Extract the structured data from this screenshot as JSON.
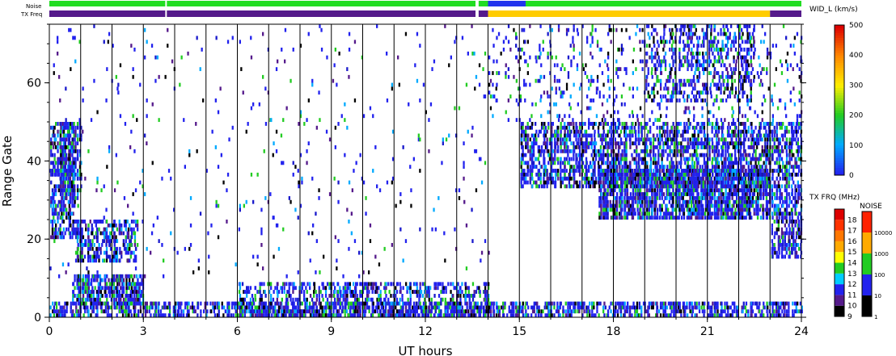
{
  "chart_data": {
    "type": "heatmap",
    "title": "",
    "xlabel": "UT hours",
    "ylabel": "Range Gate",
    "xlim": [
      0,
      24
    ],
    "ylim": [
      0,
      75
    ],
    "x_ticks": [
      "0",
      "3",
      "6",
      "9",
      "12",
      "15",
      "18",
      "21",
      "24"
    ],
    "y_ticks": [
      "0",
      "20",
      "40",
      "60"
    ],
    "hour_lines": [
      1,
      2,
      3,
      4,
      5,
      6,
      7,
      8,
      9,
      10,
      11,
      12,
      13,
      14,
      15,
      16,
      17,
      18,
      19,
      20,
      21,
      22,
      23
    ],
    "bands": {
      "noise_label": "Noise",
      "txfreq_label": "TX Freq",
      "noise_segments": [
        {
          "start": 0.0,
          "end": 3.7,
          "color": "#22dd22"
        },
        {
          "start": 3.75,
          "end": 13.6,
          "color": "#22dd22"
        },
        {
          "start": 13.7,
          "end": 14.0,
          "color": "#22dd22"
        },
        {
          "start": 14.0,
          "end": 15.2,
          "color": "#2233ee"
        },
        {
          "start": 15.2,
          "end": 24.0,
          "color": "#22dd22"
        }
      ],
      "txfreq_segments": [
        {
          "start": 0.0,
          "end": 3.7,
          "color": "#551a8b"
        },
        {
          "start": 3.75,
          "end": 13.6,
          "color": "#551a8b"
        },
        {
          "start": 13.7,
          "end": 14.0,
          "color": "#551a8b"
        },
        {
          "start": 14.0,
          "end": 23.0,
          "color": "#ffcc00"
        },
        {
          "start": 23.0,
          "end": 24.0,
          "color": "#551a8b"
        }
      ]
    },
    "colorbar_width": {
      "title": "WID_L (km/s)",
      "ticks": [
        "0",
        "100",
        "200",
        "300",
        "400",
        "500"
      ],
      "colors": [
        "#2222ee",
        "#00aaff",
        "#22cc22",
        "#ffee00",
        "#ff8800",
        "#dd0000"
      ]
    },
    "colorbar_txfreq": {
      "title": "TX FRQ (MHz)",
      "labels": [
        "9",
        "10",
        "11",
        "12",
        "13",
        "14",
        "15",
        "16",
        "17",
        "18"
      ],
      "colors": [
        "#000000",
        "#551a8b",
        "#2222ee",
        "#00ccff",
        "#22cc22",
        "#ffff00",
        "#ffaa00",
        "#ff7700",
        "#ff3300",
        "#dd0000"
      ]
    },
    "colorbar_noise": {
      "title": "NOISE",
      "labels": [
        "1",
        "10",
        "100",
        "1000",
        "10000"
      ],
      "colors": [
        "#000000",
        "#2222ee",
        "#22cc22",
        "#ffaa00",
        "#ff2200"
      ]
    },
    "scatter_regions": [
      {
        "t0": 0.0,
        "t1": 0.8,
        "g0": 20,
        "g1": 50,
        "density": 0.55
      },
      {
        "t0": 0.3,
        "t1": 1.0,
        "g0": 30,
        "g1": 50,
        "density": 0.6
      },
      {
        "t0": 0.8,
        "t1": 2.8,
        "g0": 14,
        "g1": 25,
        "density": 0.5
      },
      {
        "t0": 0.7,
        "t1": 3.0,
        "g0": 3,
        "g1": 11,
        "density": 0.7
      },
      {
        "t0": 0.0,
        "t1": 24.0,
        "g0": 0,
        "g1": 4,
        "density": 0.55
      },
      {
        "t0": 6.0,
        "t1": 14.0,
        "g0": 0,
        "g1": 9,
        "density": 0.45
      },
      {
        "t0": 15.0,
        "t1": 23.0,
        "g0": 33,
        "g1": 50,
        "density": 0.55
      },
      {
        "t0": 17.5,
        "t1": 23.0,
        "g0": 25,
        "g1": 38,
        "density": 0.75
      },
      {
        "t0": 19.0,
        "t1": 22.5,
        "g0": 55,
        "g1": 75,
        "density": 0.3
      },
      {
        "t0": 23.0,
        "t1": 24.0,
        "g0": 15,
        "g1": 50,
        "density": 0.55
      },
      {
        "t0": 14.0,
        "t1": 24.0,
        "g0": 50,
        "g1": 75,
        "density": 0.1
      },
      {
        "t0": 0.0,
        "t1": 14.0,
        "g0": 10,
        "g1": 75,
        "density": 0.02
      }
    ]
  }
}
